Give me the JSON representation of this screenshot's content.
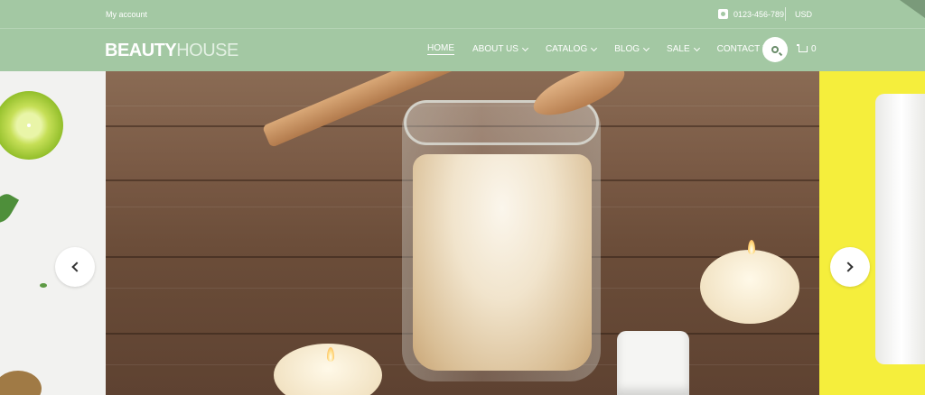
{
  "topbar": {
    "account_label": "My account",
    "phone": "0123-456-789",
    "phone_icon": "phone-icon",
    "currency": "USD"
  },
  "header": {
    "logo_part1": "BEAUTY",
    "logo_part2": "HOUSE",
    "nav": [
      {
        "label": "HOME",
        "active": true,
        "dropdown": false
      },
      {
        "label": "ABOUT US",
        "active": false,
        "dropdown": true
      },
      {
        "label": "CATALOG",
        "active": false,
        "dropdown": true
      },
      {
        "label": "BLOG",
        "active": false,
        "dropdown": true
      },
      {
        "label": "SALE",
        "active": false,
        "dropdown": true
      },
      {
        "label": "CONTACT US",
        "active": false,
        "dropdown": false
      }
    ],
    "search_icon": "search-icon",
    "cart_icon": "cart-icon",
    "cart_count": "0"
  },
  "slider": {
    "prev_icon": "chevron-left-icon",
    "next_icon": "chevron-right-icon",
    "main_image": "jar-of-sugar-scrub-with-wooden-spoon-and-candles",
    "left_image": "lime-and-leaves",
    "right_image": "cream-tube-on-yellow"
  },
  "colors": {
    "header_bg": "#a3c8a3",
    "right_panel": "#f5ee3c",
    "text_on_header": "#ffffff"
  }
}
